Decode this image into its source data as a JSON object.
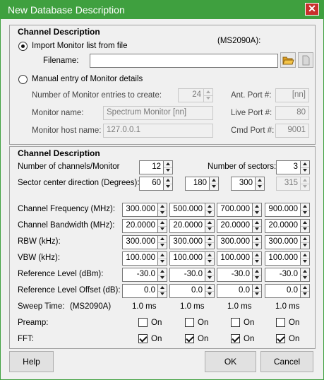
{
  "window": {
    "title": "New Database Description",
    "close_icon": "✕"
  },
  "monitor_section": {
    "header": "Channel Description",
    "model_note": "(MS2090A):",
    "import_option": "Import Monitor list from file",
    "import_selected": true,
    "filename_label": "Filename:",
    "filename_value": "",
    "manual_option": "Manual entry of Monitor details",
    "entries_label": "Number of Monitor entries to create:",
    "entries_value": "24",
    "monitor_name_label": "Monitor name:",
    "monitor_name_value": "Spectrum Monitor [nn]",
    "monitor_host_label": "Monitor host name:",
    "monitor_host_value": "127.0.0.1",
    "ant_port_label": "Ant. Port #:",
    "ant_port_value": "[nn]",
    "live_port_label": "Live Port #:",
    "live_port_value": "80",
    "cmd_port_label": "Cmd Port #:",
    "cmd_port_value": "9001"
  },
  "channel_section": {
    "header": "Channel Description",
    "channels_label": "Number of channels/Monitor",
    "channels_value": "12",
    "sectors_label": "Number of sectors:",
    "sectors_value": "3",
    "sector_dir_label": "Sector center direction (Degrees):",
    "sector_dirs": [
      "60",
      "180",
      "300",
      "315"
    ],
    "freq_label": "Channel Frequency (MHz):",
    "freq": [
      "300.000",
      "500.000",
      "700.000",
      "900.000"
    ],
    "bw_label": "Channel Bandwidth (MHz):",
    "bw": [
      "20.0000",
      "20.0000",
      "20.0000",
      "20.0000"
    ],
    "rbw_label": "RBW (kHz):",
    "rbw": [
      "300.000",
      "300.000",
      "300.000",
      "300.000"
    ],
    "vbw_label": "VBW (kHz):",
    "vbw": [
      "100.000",
      "100.000",
      "100.000",
      "100.000"
    ],
    "ref_label": "Reference Level (dBm):",
    "ref": [
      "-30.0",
      "-30.0",
      "-30.0",
      "-30.0"
    ],
    "refoff_label": "Reference Level Offset (dB):",
    "refoff": [
      "0.0",
      "0.0",
      "0.0",
      "0.0"
    ],
    "sweep_label": "Sweep Time:",
    "sweep_model": "(MS2090A)",
    "sweep": [
      "1.0 ms",
      "1.0 ms",
      "1.0 ms",
      "1.0 ms"
    ],
    "preamp_label": "Preamp:",
    "preamp_on": [
      false,
      false,
      false,
      false
    ],
    "fft_label": "FFT:",
    "fft_on": [
      true,
      true,
      true,
      true
    ],
    "on_label": "On"
  },
  "buttons": {
    "help": "Help",
    "ok": "OK",
    "cancel": "Cancel"
  },
  "icons": {
    "open_file": "folder-open-icon",
    "clear_file": "document-icon"
  },
  "colors": {
    "titlebar": "#3fa03f",
    "close": "#c8302c"
  }
}
